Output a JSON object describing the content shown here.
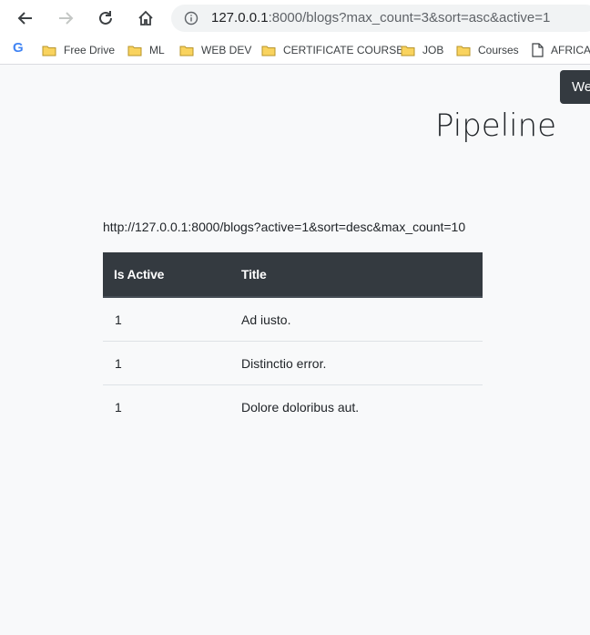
{
  "browser": {
    "url_host": "127.0.0.1",
    "url_rest": ":8000/blogs?max_count=3&sort=asc&active=1"
  },
  "bookmarks": [
    {
      "label": "Free Drive",
      "icon": "folder-icon"
    },
    {
      "label": "ML",
      "icon": "folder-icon"
    },
    {
      "label": "WEB DEV",
      "icon": "folder-icon"
    },
    {
      "label": "CERTIFICATE COURSE",
      "icon": "folder-icon"
    },
    {
      "label": "JOB",
      "icon": "folder-icon"
    },
    {
      "label": "Courses",
      "icon": "folder-icon"
    },
    {
      "label": "AFRICAI",
      "icon": "page-icon"
    }
  ],
  "bookmark_google_letter": "G",
  "toast": {
    "text": "We"
  },
  "page": {
    "title": "Pipeline",
    "api_link": "http://127.0.0.1:8000/blogs?active=1&sort=desc&max_count=10"
  },
  "table": {
    "headers": [
      "Is Active",
      "Title"
    ],
    "rows": [
      [
        "1",
        "Ad iusto."
      ],
      [
        "1",
        "Distinctio error."
      ],
      [
        "1",
        "Dolore doloribus aut."
      ]
    ]
  },
  "colors": {
    "header_bg": "#343a40",
    "page_bg": "#f8f9fa",
    "folder": "#f9d35e"
  }
}
